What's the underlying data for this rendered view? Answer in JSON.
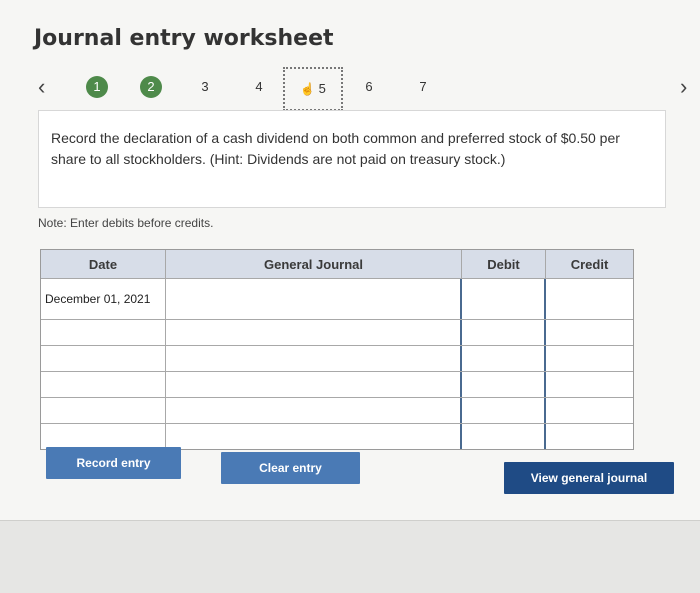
{
  "page": {
    "title": "Journal entry worksheet"
  },
  "nav": {
    "prev_icon": "chevron-left-icon",
    "next_icon": "chevron-right-icon",
    "steps": [
      "1",
      "2",
      "3",
      "4",
      "5",
      "6",
      "7"
    ]
  },
  "prompt": {
    "text": "Record the declaration of a cash dividend on both common and preferred stock of $0.50 per share to all stockholders. (Hint: Dividends are not paid on treasury stock.)"
  },
  "note": "Note: Enter debits before credits.",
  "table": {
    "headers": [
      "Date",
      "General Journal",
      "Debit",
      "Credit"
    ],
    "rows": [
      {
        "date": "December 01, 2021",
        "account": "",
        "debit": "",
        "credit": ""
      },
      {
        "date": "",
        "account": "",
        "debit": "",
        "credit": ""
      },
      {
        "date": "",
        "account": "",
        "debit": "",
        "credit": ""
      },
      {
        "date": "",
        "account": "",
        "debit": "",
        "credit": ""
      },
      {
        "date": "",
        "account": "",
        "debit": "",
        "credit": ""
      },
      {
        "date": "",
        "account": "",
        "debit": "",
        "credit": ""
      }
    ]
  },
  "buttons": {
    "record": "Record entry",
    "clear": "Clear entry",
    "view": "View general journal"
  },
  "colors": {
    "step_done": "#4e8a4a",
    "button_blue": "#4a7ab5",
    "button_dark": "#1f4b85",
    "header_bg": "#d7dde8"
  }
}
